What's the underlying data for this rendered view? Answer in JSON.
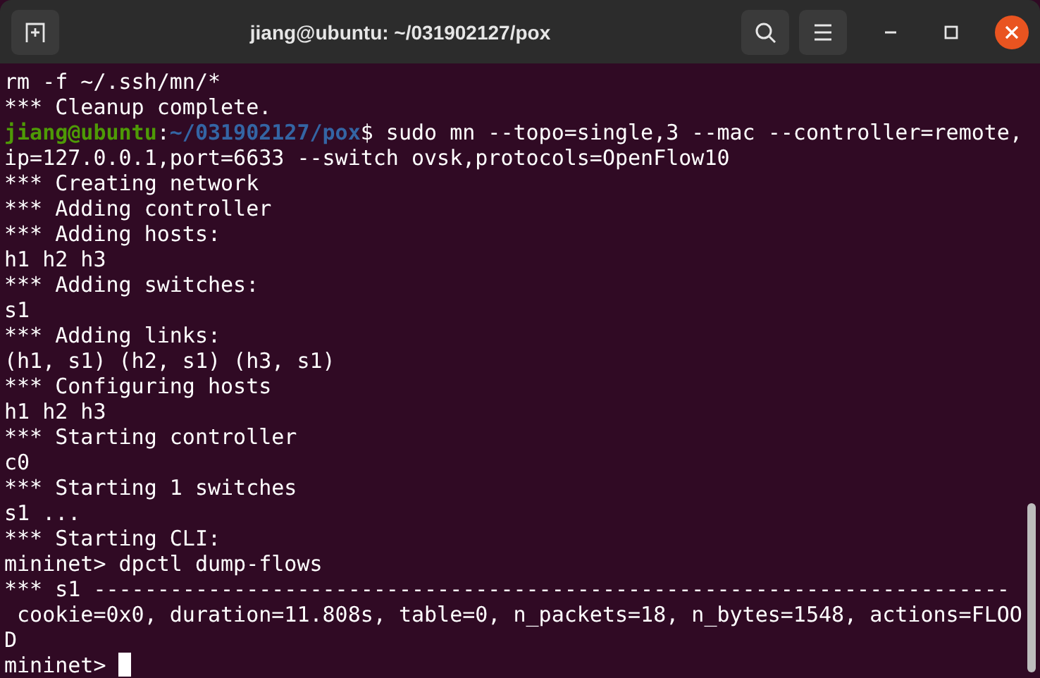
{
  "window": {
    "title": "jiang@ubuntu: ~/031902127/pox"
  },
  "terminal": {
    "lines": [
      {
        "text": "rm -f ~/.ssh/mn/*"
      },
      {
        "text": "*** Cleanup complete."
      },
      {
        "prompt": {
          "user_host": "jiang@ubuntu",
          "separator": ":",
          "path": "~/031902127/pox"
        },
        "text": "$ sudo mn --topo=single,3 --mac --controller=remote,"
      },
      {
        "text": "ip=127.0.0.1,port=6633 --switch ovsk,protocols=OpenFlow10"
      },
      {
        "text": "*** Creating network"
      },
      {
        "text": "*** Adding controller"
      },
      {
        "text": "*** Adding hosts:"
      },
      {
        "text": "h1 h2 h3"
      },
      {
        "text": "*** Adding switches:"
      },
      {
        "text": "s1"
      },
      {
        "text": "*** Adding links:"
      },
      {
        "text": "(h1, s1) (h2, s1) (h3, s1)"
      },
      {
        "text": "*** Configuring hosts"
      },
      {
        "text": "h1 h2 h3"
      },
      {
        "text": "*** Starting controller"
      },
      {
        "text": "c0"
      },
      {
        "text": "*** Starting 1 switches"
      },
      {
        "text": "s1 ..."
      },
      {
        "text": "*** Starting CLI:"
      },
      {
        "text": "mininet> dpctl dump-flows"
      },
      {
        "text": "*** s1 ------------------------------------------------------------------------"
      },
      {
        "text": " cookie=0x0, duration=11.808s, table=0, n_packets=18, n_bytes=1548, actions=FLOO"
      },
      {
        "text": "D"
      },
      {
        "text": "mininet> ",
        "cursor": true
      }
    ]
  }
}
